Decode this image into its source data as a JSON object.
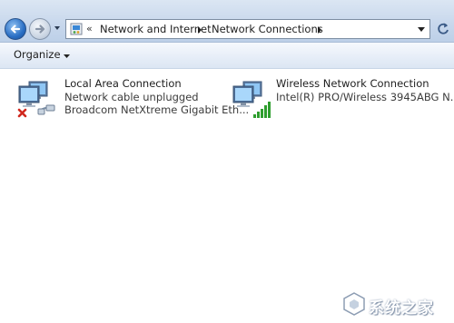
{
  "address_bar": {
    "breadcrumb_overflow": "«",
    "crumbs": [
      "Network and Internet",
      "Network Connections"
    ]
  },
  "command_bar": {
    "organize_label": "Organize"
  },
  "connections": [
    {
      "name": "Local Area Connection",
      "status": "Network cable unplugged",
      "device": "Broadcom NetXtreme Gigabit Eth...",
      "icon": "wired-network-disconnected-icon"
    },
    {
      "name": "Wireless Network Connection",
      "status": "",
      "device": "Intel(R) PRO/Wireless 3945ABG N...",
      "icon": "wireless-network-icon"
    }
  ],
  "watermark": {
    "text": "系统之家"
  },
  "colors": {
    "address_bar_top": "#dbe6f3",
    "address_bar_bottom": "#bdd0e8",
    "back_button": "#2a6fc4",
    "signal_green": "#2f9e2f",
    "disconnect_red": "#d0281e"
  }
}
